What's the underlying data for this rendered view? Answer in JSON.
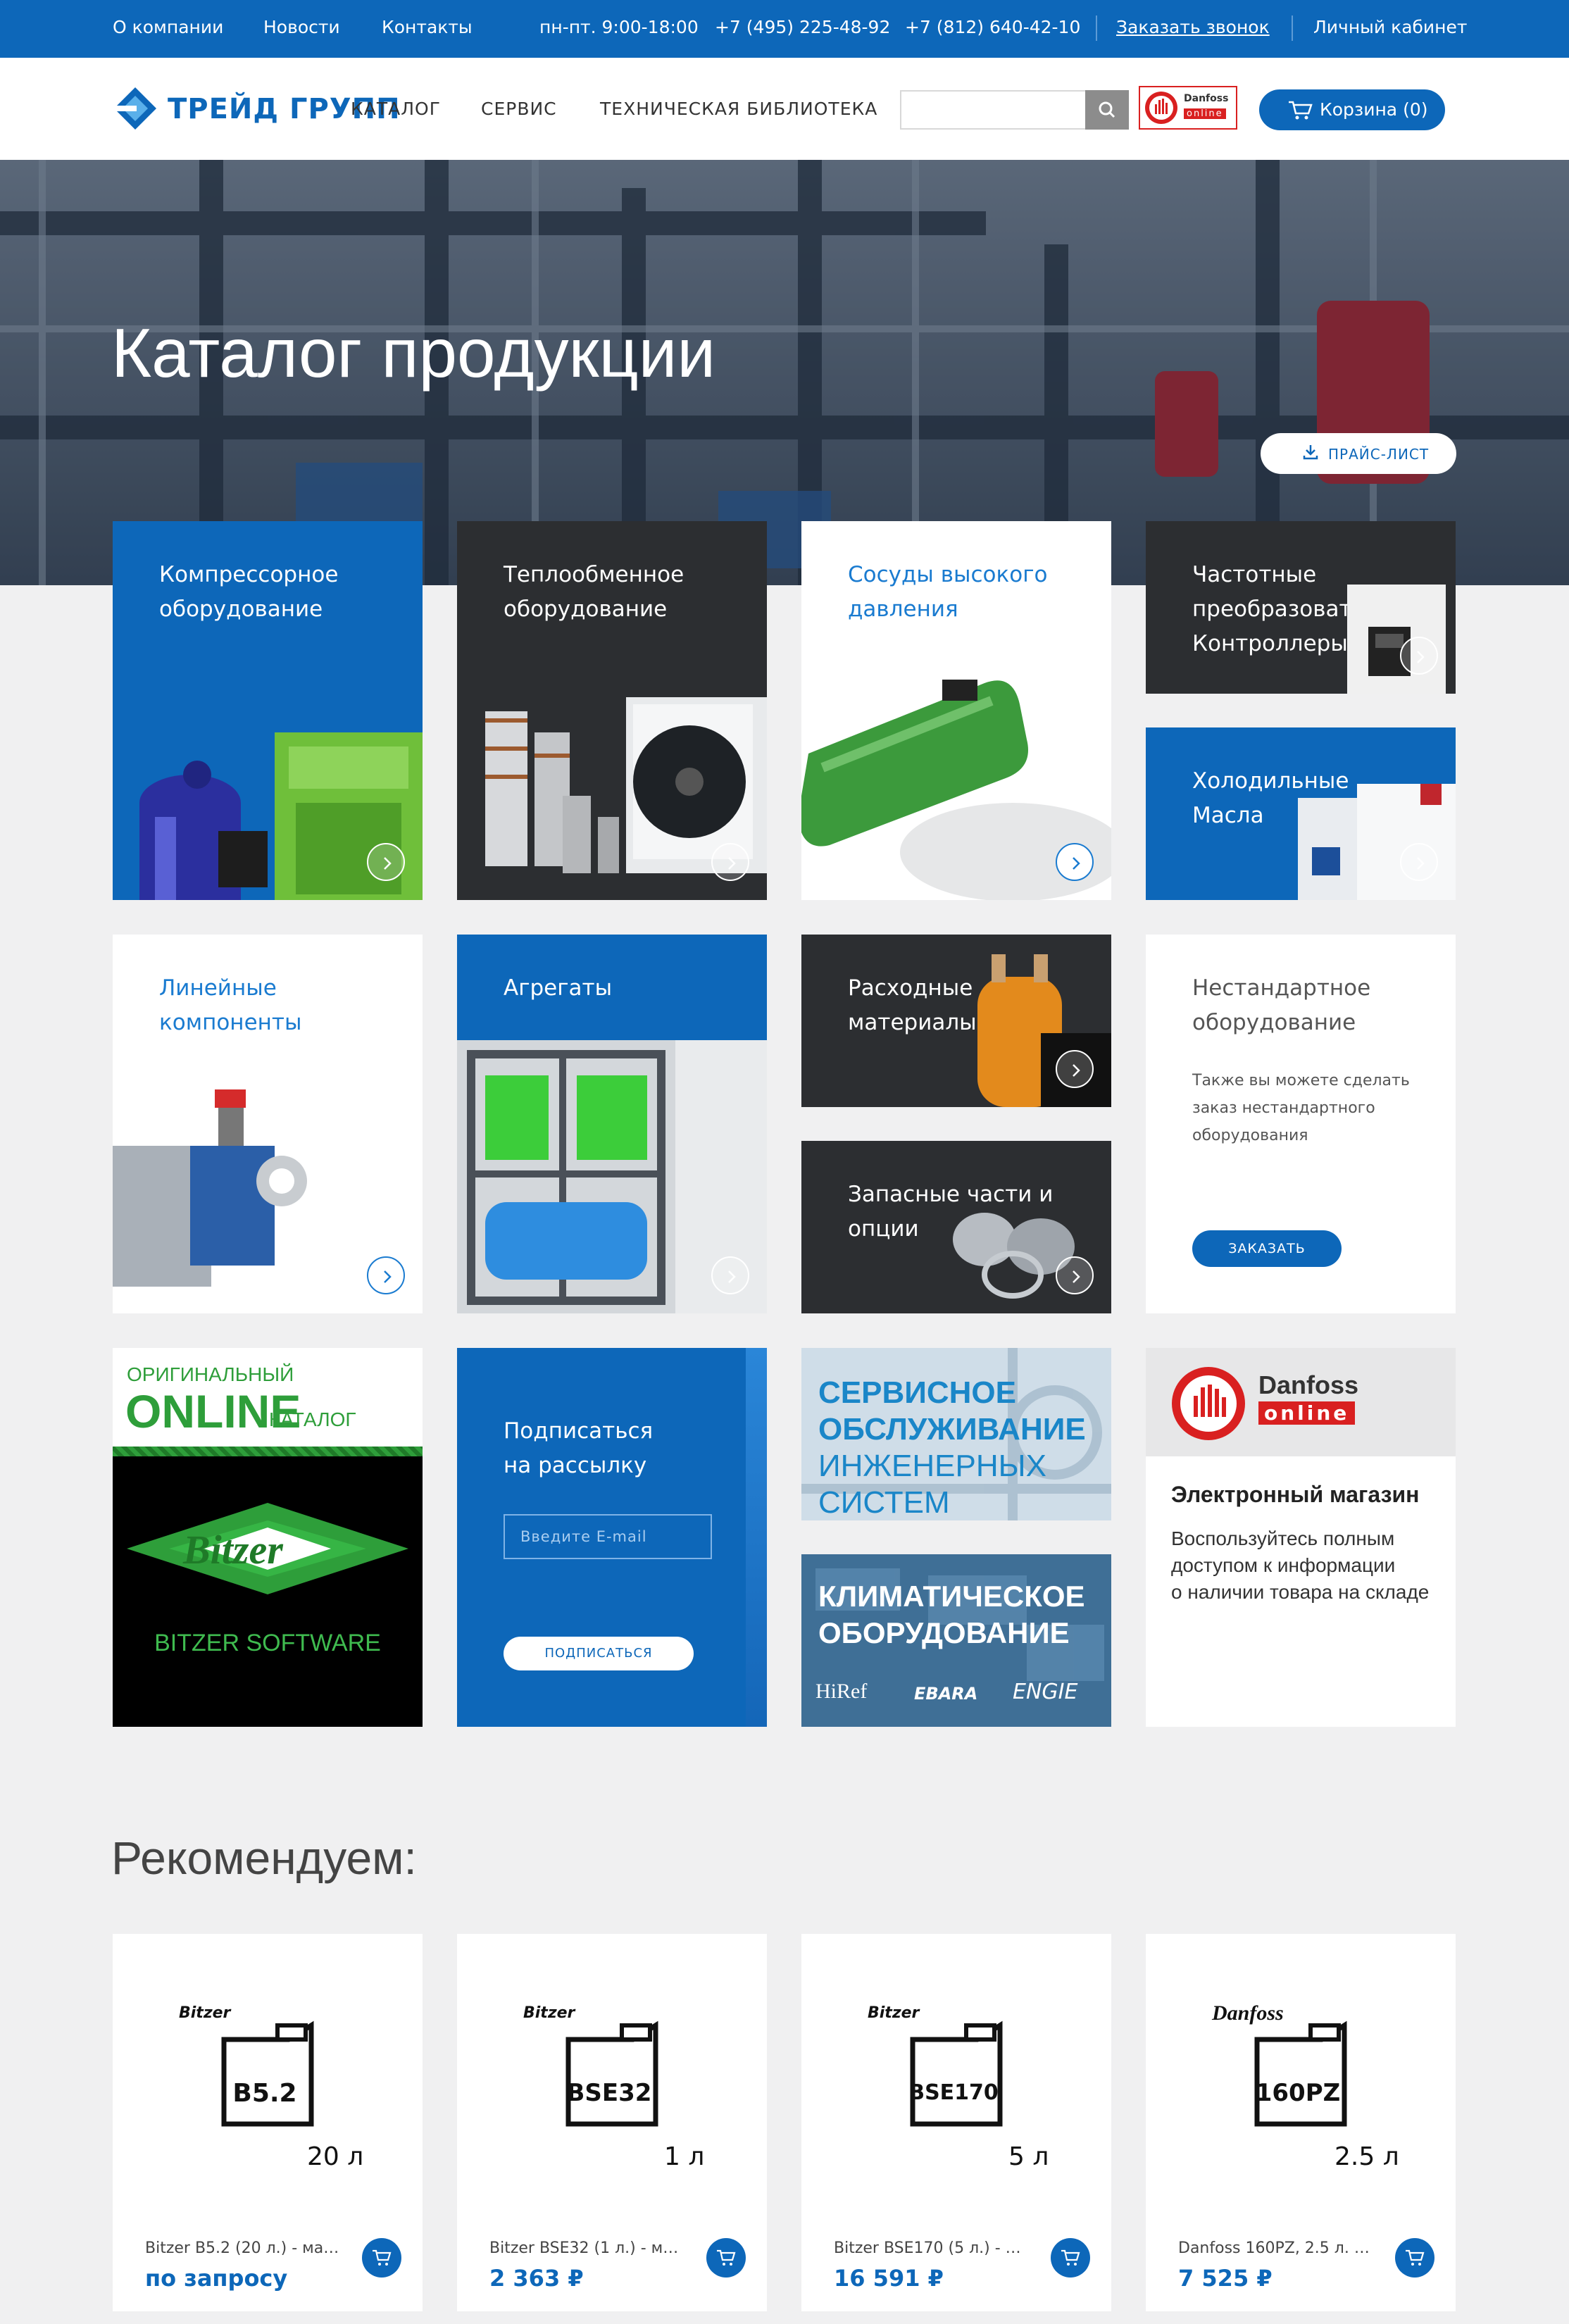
{
  "topbar": {
    "about": "О компании",
    "news": "Новости",
    "contacts": "Контакты",
    "hours": "пн-пт. 9:00-18:00",
    "phone_msk": "+7 (495) 225-48-92",
    "phone_spb": "+7 (812) 640-42-10",
    "callback": "Заказать звонок",
    "account": "Личный кабинет"
  },
  "header": {
    "logo": "ТРЕЙД ГРУПП",
    "nav": [
      "КАТАЛОГ",
      "СЕРВИС",
      "ТЕХНИЧЕСКАЯ БИБЛИОТЕКА"
    ],
    "search_placeholder": "",
    "danfoss_badge": [
      "Danfoss",
      "online"
    ],
    "cart_label": "Корзина (0)"
  },
  "hero": {
    "title": "Каталог продукции",
    "price_list": "ПРАЙС-ЛИСТ"
  },
  "categories": {
    "compressor": [
      "Компрессорное",
      "оборудование"
    ],
    "heat_exchange": [
      "Теплообменное",
      "оборудование"
    ],
    "vessels": [
      "Сосуды высокого",
      "давления"
    ],
    "inverters": [
      "Частотные",
      "преобразователи,",
      "Контроллеры"
    ],
    "oils": [
      "Холодильные",
      "Масла"
    ],
    "line_components": [
      "Линейные",
      "компоненты"
    ],
    "aggregates": [
      "Агрегаты"
    ],
    "consumables": [
      "Расходные",
      "материалы"
    ],
    "spare_parts": [
      "Запасные части и",
      "опции"
    ],
    "custom": {
      "title": [
        "Нестандартное",
        "оборудование"
      ],
      "text": [
        "Также вы можете сделать",
        "заказ нестандартного",
        "оборудования"
      ],
      "button": "ЗАКАЗАТЬ"
    }
  },
  "promos": {
    "bitzer": {
      "top": "ОРИГИНАЛЬНЫЙ",
      "online": "ONLINE",
      "catalog": "КАТАЛОГ",
      "logo": "Bitzer",
      "software": "BITZER SOFTWARE"
    },
    "subscribe": {
      "title": [
        "Подписаться",
        "на рассылку"
      ],
      "email_placeholder": "Введите E-mail",
      "button": "ПОДПИСАТЬСЯ"
    },
    "service": [
      "СЕРВИСНОЕ",
      "ОБСЛУЖИВАНИЕ",
      "ИНЖЕНЕРНЫХ СИСТЕМ"
    ],
    "climate": {
      "title": [
        "КЛИМАТИЧЕСКОЕ",
        "ОБОРУДОВАНИЕ"
      ],
      "brands": [
        "HiRef",
        "EBARA",
        "ENGIE"
      ]
    },
    "danfoss_shop": {
      "brand": "Danfoss",
      "online": "online",
      "title": "Электронный магазин",
      "text": [
        "Воспользуйтесь полным",
        "доступом к информации",
        "о наличии товара на складе"
      ]
    }
  },
  "recommend": {
    "title": "Рекомендуем:",
    "items": [
      {
        "brand": "Bitzer",
        "code": "B5.2",
        "volume": "20 л",
        "name": "Bitzer B5.2 (20 л.) - ма…",
        "price": "по запросу"
      },
      {
        "brand": "Bitzer",
        "code": "BSE32",
        "volume": "1 л",
        "name": "Bitzer BSE32 (1 л.) - м…",
        "price": "2 363 ₽"
      },
      {
        "brand": "Bitzer",
        "code": "BSE170",
        "volume": "5 л",
        "name": "Bitzer BSE170 (5 л.) - …",
        "price": "16 591 ₽"
      },
      {
        "brand": "Danfoss",
        "code": "160PZ",
        "volume": "2.5 л",
        "name": "Danfoss 160PZ, 2.5 л. …",
        "price": "7 525 ₽"
      }
    ]
  },
  "colors": {
    "brand_blue": "#0d67b9",
    "dark_tile": "#2c2e31",
    "danfoss_red": "#d92020",
    "bitzer_green": "#2e9e3a"
  }
}
